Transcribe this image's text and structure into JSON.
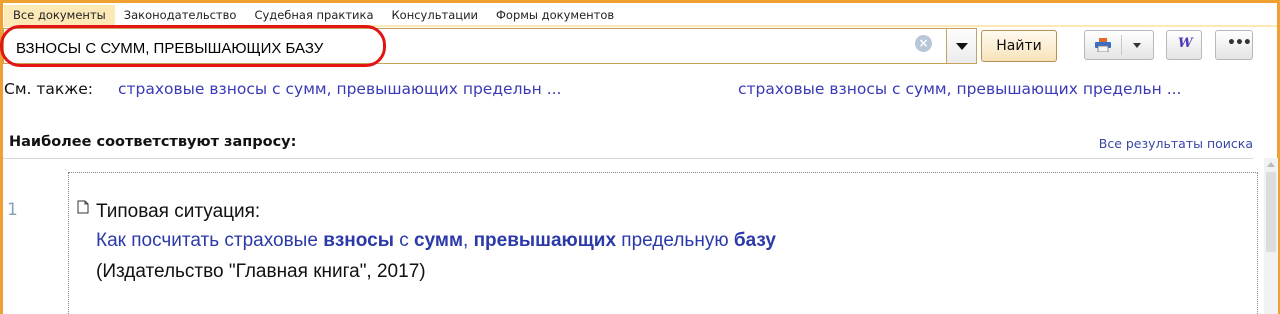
{
  "tabs": [
    {
      "label": "Все документы",
      "active": true
    },
    {
      "label": "Законодательство",
      "active": false
    },
    {
      "label": "Судебная практика",
      "active": false
    },
    {
      "label": "Консультации",
      "active": false
    },
    {
      "label": "Формы документов",
      "active": false
    }
  ],
  "search": {
    "value": "ВЗНОСЫ С СУММ, ПРЕВЫШАЮЩИХ БАЗУ",
    "find_label": "Найти",
    "clear_icon": "×"
  },
  "toolbar": {
    "word_label": "W",
    "more_label": "•••"
  },
  "see_also": {
    "label": "См. также:",
    "links": [
      "страховые взносы с сумм, превышающих предельн ...",
      "страховые взносы с сумм, превышающих предельн ..."
    ]
  },
  "results": {
    "title": "Наиболее соответствуют запросу:",
    "all_results_label": "Все результаты поиска",
    "items": [
      {
        "number": "1",
        "type": "Типовая ситуация:",
        "title_parts": [
          {
            "text": "Как посчитать страховые ",
            "bold": false
          },
          {
            "text": "взносы",
            "bold": true
          },
          {
            "text": " с ",
            "bold": false
          },
          {
            "text": "сумм",
            "bold": true
          },
          {
            "text": ", ",
            "bold": false
          },
          {
            "text": "превышающих",
            "bold": true
          },
          {
            "text": " предельную ",
            "bold": false
          },
          {
            "text": "базу",
            "bold": true
          }
        ],
        "source": "(Издательство \"Главная книга\", 2017)"
      }
    ]
  },
  "colors": {
    "frame": "#f0a030",
    "highlight": "#e31414",
    "link": "#3a3ab8"
  }
}
